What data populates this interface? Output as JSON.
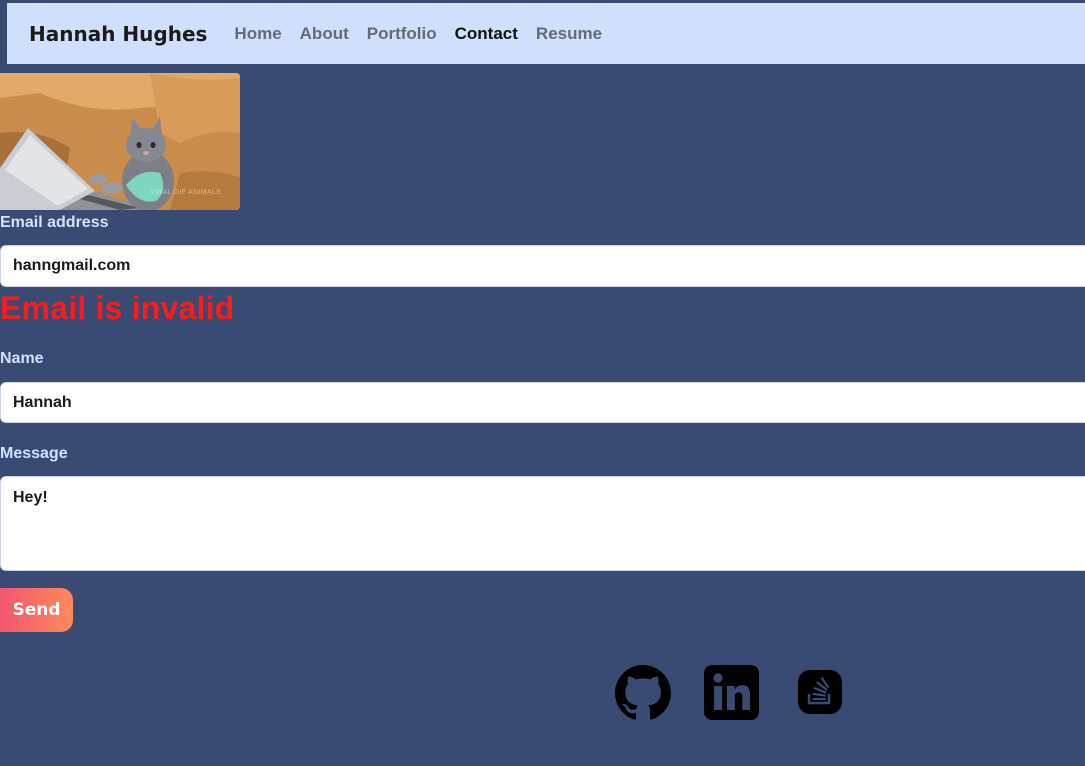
{
  "navbar": {
    "brand": "Hannah Hughes",
    "links": [
      {
        "label": "Home",
        "active": false
      },
      {
        "label": "About",
        "active": false
      },
      {
        "label": "Portfolio",
        "active": false
      },
      {
        "label": "Contact",
        "active": true
      },
      {
        "label": "Resume",
        "active": false
      }
    ]
  },
  "hero": {
    "image_icon": "cat-typing-on-laptop-gif",
    "watermark": "VIRAL GIF ANIMALS"
  },
  "form": {
    "email": {
      "label": "Email address",
      "value": "hanngmail.com"
    },
    "error": "Email is invalid",
    "name": {
      "label": "Name",
      "value": "Hannah"
    },
    "message": {
      "label": "Message",
      "value": "Hey!"
    },
    "submit_label": "Send"
  },
  "social": [
    {
      "name": "github-icon"
    },
    {
      "name": "linkedin-icon"
    },
    {
      "name": "stackoverflow-icon"
    }
  ],
  "colors": {
    "page_background": "#3a4b73",
    "navbar_background": "#d0dffb",
    "label_color": "#d3e1ff",
    "error_color": "#ff1a1a",
    "button_gradient_start": "#f2566f",
    "button_gradient_end": "#ff8a5c"
  }
}
